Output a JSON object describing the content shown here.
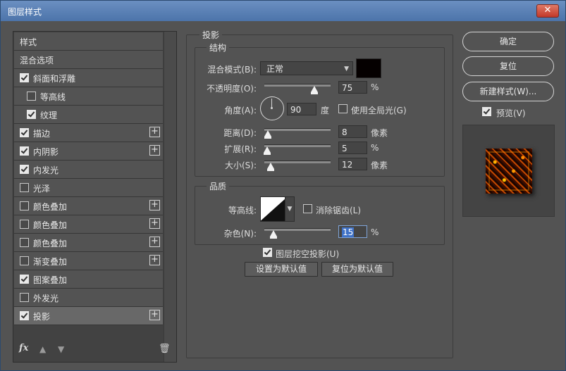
{
  "window": {
    "title": "图层样式",
    "close_glyph": "✕"
  },
  "left_panel": {
    "header": "样式",
    "blend_options": "混合选项",
    "items": [
      {
        "label": "斜面和浮雕",
        "checked": true,
        "plus": false,
        "indent": 0
      },
      {
        "label": "等高线",
        "checked": false,
        "plus": false,
        "indent": 1
      },
      {
        "label": "纹理",
        "checked": true,
        "plus": false,
        "indent": 1
      },
      {
        "label": "描边",
        "checked": true,
        "plus": true,
        "indent": 0
      },
      {
        "label": "内阴影",
        "checked": true,
        "plus": true,
        "indent": 0
      },
      {
        "label": "内发光",
        "checked": true,
        "plus": false,
        "indent": 0
      },
      {
        "label": "光泽",
        "checked": false,
        "plus": false,
        "indent": 0
      },
      {
        "label": "颜色叠加",
        "checked": false,
        "plus": true,
        "indent": 0
      },
      {
        "label": "颜色叠加",
        "checked": false,
        "plus": true,
        "indent": 0
      },
      {
        "label": "颜色叠加",
        "checked": false,
        "plus": true,
        "indent": 0
      },
      {
        "label": "渐变叠加",
        "checked": false,
        "plus": true,
        "indent": 0
      },
      {
        "label": "图案叠加",
        "checked": true,
        "plus": false,
        "indent": 0
      },
      {
        "label": "外发光",
        "checked": false,
        "plus": false,
        "indent": 0
      },
      {
        "label": "投影",
        "checked": true,
        "plus": true,
        "indent": 0,
        "selected": true
      }
    ],
    "footer": {
      "fx": "fx",
      "up": "▲",
      "down": "▼",
      "trash": "🗑"
    }
  },
  "drop_shadow": {
    "title": "投影",
    "structure": {
      "title": "结构",
      "blend_mode_label": "混合模式(B):",
      "blend_mode_value": "正常",
      "opacity_label": "不透明度(O):",
      "opacity_value": "75",
      "opacity_unit": "%",
      "opacity_level": 75,
      "angle_label": "角度(A):",
      "angle_value": "90",
      "angle_unit": "度",
      "global_light_label": "使用全局光(G)",
      "global_light_checked": false,
      "distance_label": "距离(D):",
      "distance_value": "8",
      "distance_unit": "像素",
      "spread_label": "扩展(R):",
      "spread_value": "5",
      "spread_unit": "%",
      "size_label": "大小(S):",
      "size_value": "12",
      "size_unit": "像素"
    },
    "quality": {
      "title": "品质",
      "contour_label": "等高线:",
      "antialias_label": "消除锯齿(L)",
      "antialias_checked": false,
      "noise_label": "杂色(N):",
      "noise_value": "15",
      "noise_unit": "%"
    },
    "knockout_label": "图层挖空投影(U)",
    "knockout_checked": true,
    "set_default": "设置为默认值",
    "reset_default": "复位为默认值"
  },
  "right": {
    "ok": "确定",
    "reset": "复位",
    "new_style": "新建样式(W)...",
    "preview_label": "预览(V)",
    "preview_checked": true
  },
  "colors": {
    "shadow_color": "#050000",
    "selected_row": "#686868",
    "panel_bg": "#535353"
  },
  "icons": [
    "close-icon",
    "fx-icon",
    "move-up-icon",
    "move-down-icon",
    "trash-icon",
    "plus-icon",
    "angle-dial-icon",
    "checkbox-icon"
  ]
}
